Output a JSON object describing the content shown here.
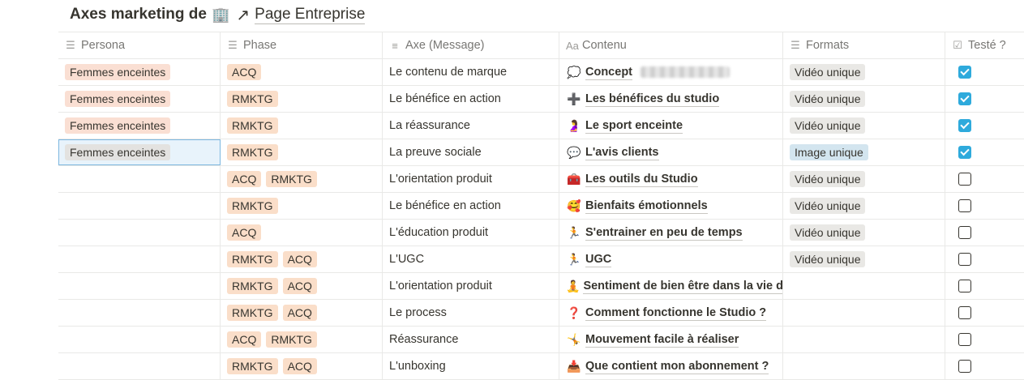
{
  "page": {
    "title_prefix": "Axes marketing de",
    "building_emoji": "🏢",
    "arrow": "↗",
    "link": "Page Entreprise"
  },
  "columns": [
    {
      "label": "Persona",
      "icon": "list-icon",
      "glyph": "☰"
    },
    {
      "label": "Phase",
      "icon": "list-icon",
      "glyph": "☰"
    },
    {
      "label": "Axe (Message)",
      "icon": "text-icon",
      "glyph": "≡"
    },
    {
      "label": "Contenu",
      "icon": "title-icon",
      "glyph": "Aa"
    },
    {
      "label": "Formats",
      "icon": "list-icon",
      "glyph": "☰"
    },
    {
      "label": "Testé ?",
      "icon": "checkbox-icon",
      "glyph": "☑"
    }
  ],
  "rows": [
    {
      "persona": "Femmes enceintes",
      "phase": [
        "ACQ"
      ],
      "axe": "Le contenu de marque",
      "emoji": "💭",
      "contenu": "Concept",
      "blurred": true,
      "format": "Vidéo unique",
      "format_style": "gray",
      "tested": true
    },
    {
      "persona": "Femmes enceintes",
      "phase": [
        "RMKTG"
      ],
      "axe": "Le bénéfice en action",
      "emoji": "➕",
      "contenu": "Les bénéfices du studio",
      "format": "Vidéo unique",
      "format_style": "gray",
      "tested": true
    },
    {
      "persona": "Femmes enceintes",
      "phase": [
        "RMKTG"
      ],
      "axe": "La réassurance",
      "emoji": "🤰",
      "contenu": "Le sport enceinte",
      "format": "Vidéo unique",
      "format_style": "gray",
      "tested": true
    },
    {
      "persona": "Femmes enceintes",
      "persona_selected": true,
      "phase": [
        "RMKTG"
      ],
      "axe": "La preuve sociale",
      "emoji": "💬",
      "contenu": "L'avis clients",
      "format": "Image unique",
      "format_style": "blue",
      "tested": true
    },
    {
      "persona": "",
      "phase": [
        "ACQ",
        "RMKTG"
      ],
      "axe": "L'orientation produit",
      "emoji": "🧰",
      "contenu": "Les outils du Studio",
      "format": "Vidéo unique",
      "format_style": "gray",
      "tested": false
    },
    {
      "persona": "",
      "phase": [
        "RMKTG"
      ],
      "axe": "Le bénéfice en action",
      "emoji": "🥰",
      "contenu": "Bienfaits émotionnels",
      "format": "Vidéo unique",
      "format_style": "gray",
      "tested": false
    },
    {
      "persona": "",
      "phase": [
        "ACQ"
      ],
      "axe": "L'éducation produit",
      "emoji": "🏃",
      "contenu": "S'entrainer en peu de temps",
      "format": "Vidéo unique",
      "format_style": "gray",
      "tested": false
    },
    {
      "persona": "",
      "phase": [
        "RMKTG",
        "ACQ"
      ],
      "axe": "L'UGC",
      "emoji": "🏃",
      "contenu": "UGC",
      "format": "Vidéo unique",
      "format_style": "gray",
      "tested": false
    },
    {
      "persona": "",
      "phase": [
        "RMKTG",
        "ACQ"
      ],
      "axe": "L'orientation produit",
      "emoji": "🧘",
      "contenu": "Sentiment de bien être dans la vie de",
      "format": "",
      "format_style": "gray",
      "tested": false
    },
    {
      "persona": "",
      "phase": [
        "RMKTG",
        "ACQ"
      ],
      "axe": "Le process",
      "emoji": "❓",
      "contenu": "Comment fonctionne le Studio ?",
      "format": "",
      "format_style": "gray",
      "tested": false
    },
    {
      "persona": "",
      "phase": [
        "ACQ",
        "RMKTG"
      ],
      "axe": "Réassurance",
      "emoji": "🤸",
      "contenu": "Mouvement facile à réaliser",
      "format": "",
      "format_style": "gray",
      "tested": false
    },
    {
      "persona": "",
      "phase": [
        "RMKTG",
        "ACQ"
      ],
      "axe": "L'unboxing",
      "emoji": "📥",
      "contenu": "Que contient mon abonnement ?",
      "format": "",
      "format_style": "gray",
      "tested": false
    }
  ],
  "colors": {
    "persona_tag": "#fadfd3",
    "phase_tag": "#fadec9",
    "format_gray": "#e9e8e5",
    "format_blue": "#d3e5ef",
    "checkbox_checked": "#2eaadc",
    "selection": "#7cb7e0"
  }
}
